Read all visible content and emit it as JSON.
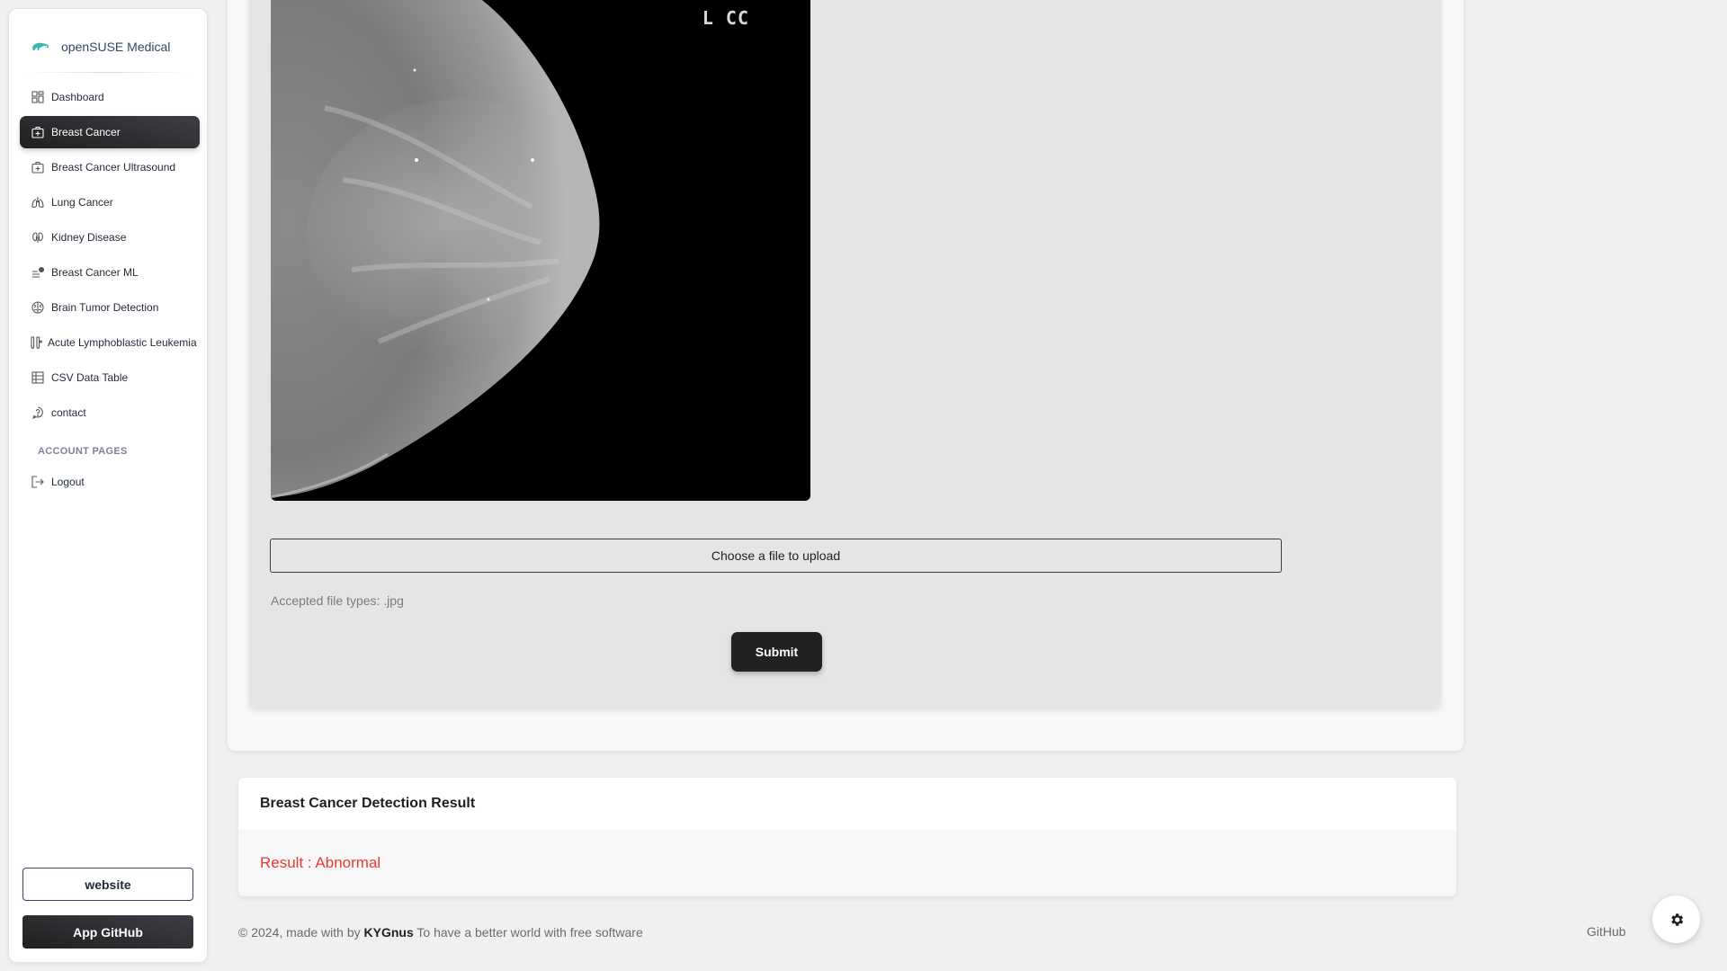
{
  "sidebar": {
    "brand": "openSUSE Medical",
    "items": [
      {
        "label": "Dashboard",
        "icon": "dashboard-icon",
        "active": false
      },
      {
        "label": "Breast Cancer",
        "icon": "medical-case-icon",
        "active": true
      },
      {
        "label": "Breast Cancer Ultrasound",
        "icon": "medical-case-icon",
        "active": false
      },
      {
        "label": "Lung Cancer",
        "icon": "lungs-icon",
        "active": false
      },
      {
        "label": "Kidney Disease",
        "icon": "kidney-icon",
        "active": false
      },
      {
        "label": "Breast Cancer ML",
        "icon": "ml-list-icon",
        "active": false
      },
      {
        "label": "Brain Tumor Detection",
        "icon": "brain-icon",
        "active": false
      },
      {
        "label": "Acute Lymphoblastic Leukemia",
        "icon": "test-tubes-icon",
        "active": false
      },
      {
        "label": "CSV Data Table",
        "icon": "table-icon",
        "active": false
      },
      {
        "label": "contact",
        "icon": "help-icon",
        "active": false
      }
    ],
    "section_label": "ACCOUNT PAGES",
    "logout_label": "Logout",
    "website_button": "website",
    "github_button": "App GitHub"
  },
  "upload": {
    "image_label": "L CC",
    "file_input_label": "Choose a file to upload",
    "accepted_types": "Accepted file types: .jpg",
    "submit_label": "Submit"
  },
  "result": {
    "title": "Breast Cancer Detection Result",
    "text": "Result : Abnormal",
    "color": "#e53935"
  },
  "footer": {
    "prefix": "© 2024, made with by",
    "author": "KYGnus",
    "suffix": "To have a better world with free software",
    "link": "GitHub"
  },
  "colors": {
    "active_nav": "#2d2d2d",
    "accent_green": "#35b9ab"
  }
}
